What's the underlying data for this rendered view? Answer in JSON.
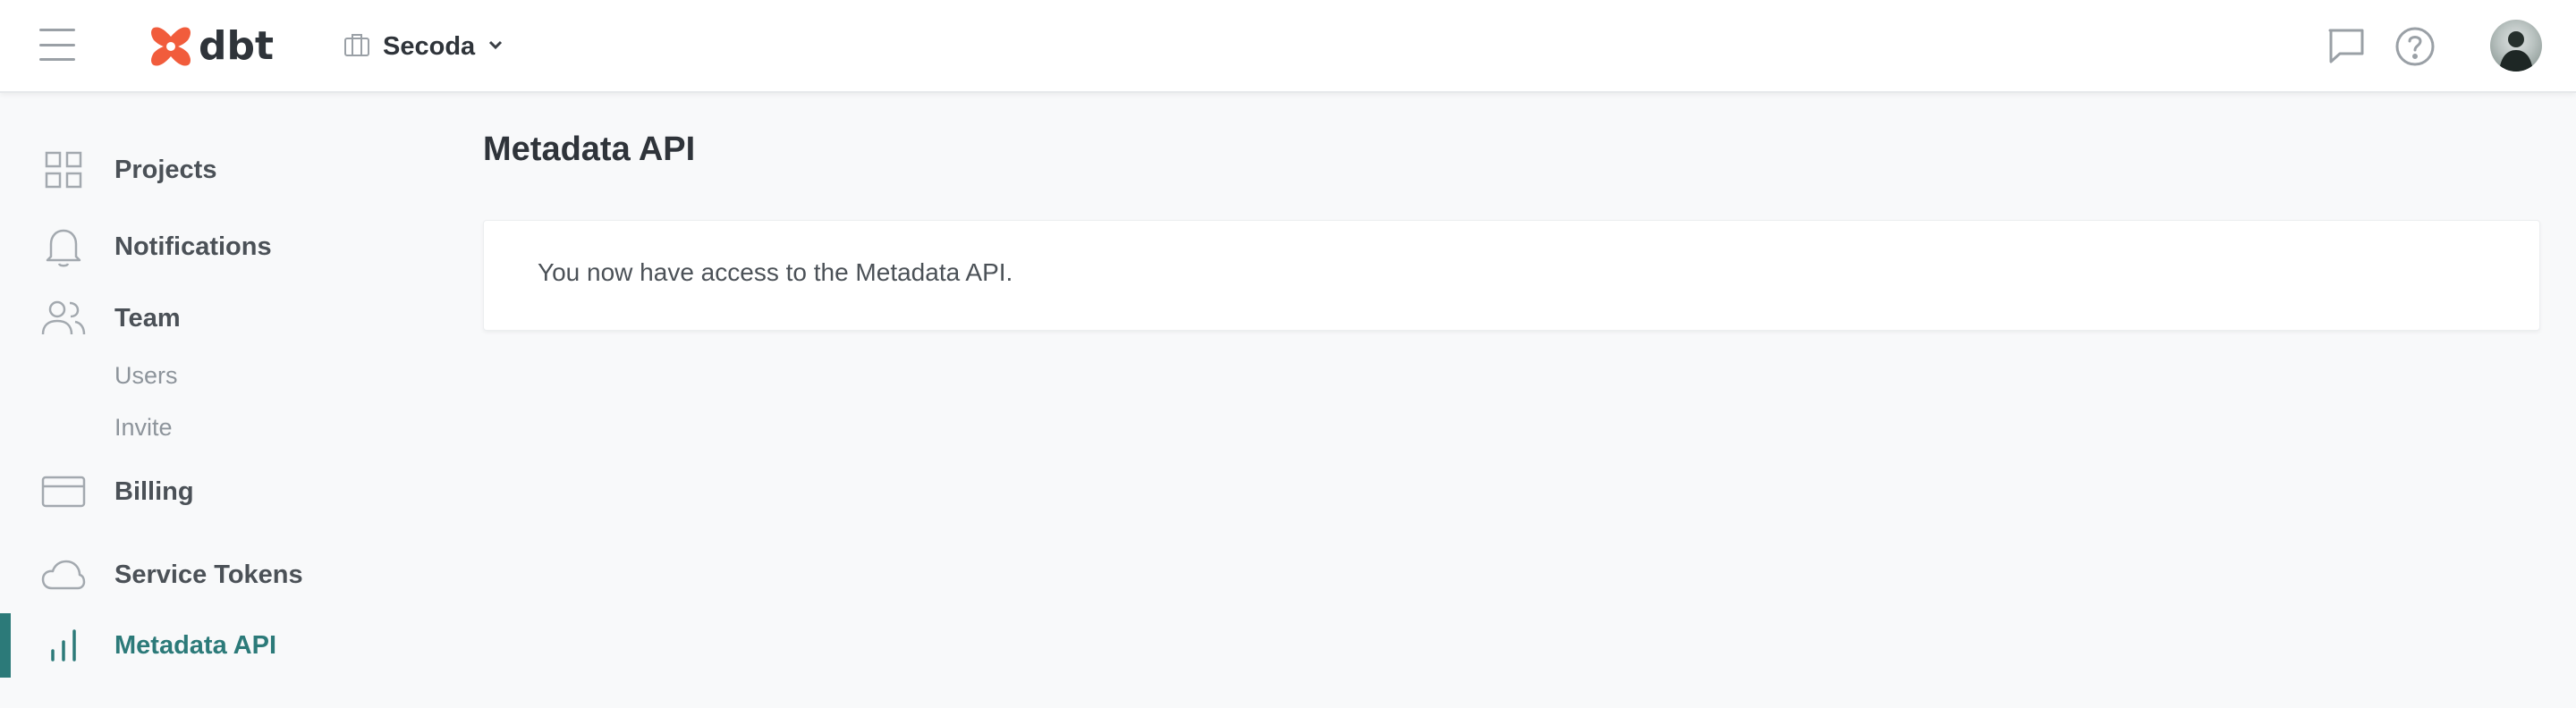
{
  "header": {
    "logo_text": "dbt",
    "account_name": "Secoda",
    "icons": {
      "menu": "hamburger-menu-icon",
      "logo": "dbt-logo-icon",
      "account": "briefcase-icon",
      "dropdown": "chevron-down-icon",
      "chat": "chat-bubble-icon",
      "help": "help-circle-icon",
      "avatar": "user-avatar"
    }
  },
  "sidebar": {
    "items": [
      {
        "label": "Projects",
        "icon": "grid-icon"
      },
      {
        "label": "Notifications",
        "icon": "bell-icon"
      },
      {
        "label": "Team",
        "icon": "users-icon",
        "children": [
          {
            "label": "Users"
          },
          {
            "label": "Invite"
          }
        ]
      },
      {
        "label": "Billing",
        "icon": "credit-card-icon"
      },
      {
        "label": "Service Tokens",
        "icon": "cloud-icon"
      },
      {
        "label": "Metadata API",
        "icon": "bar-chart-icon",
        "active": true
      }
    ]
  },
  "main": {
    "title": "Metadata API",
    "card_message": "You now have access to the Metadata API."
  },
  "colors": {
    "accent": "#2c7a79",
    "brand_logo": "#f15c3c",
    "background": "#f8f9fa",
    "surface": "#ffffff"
  }
}
